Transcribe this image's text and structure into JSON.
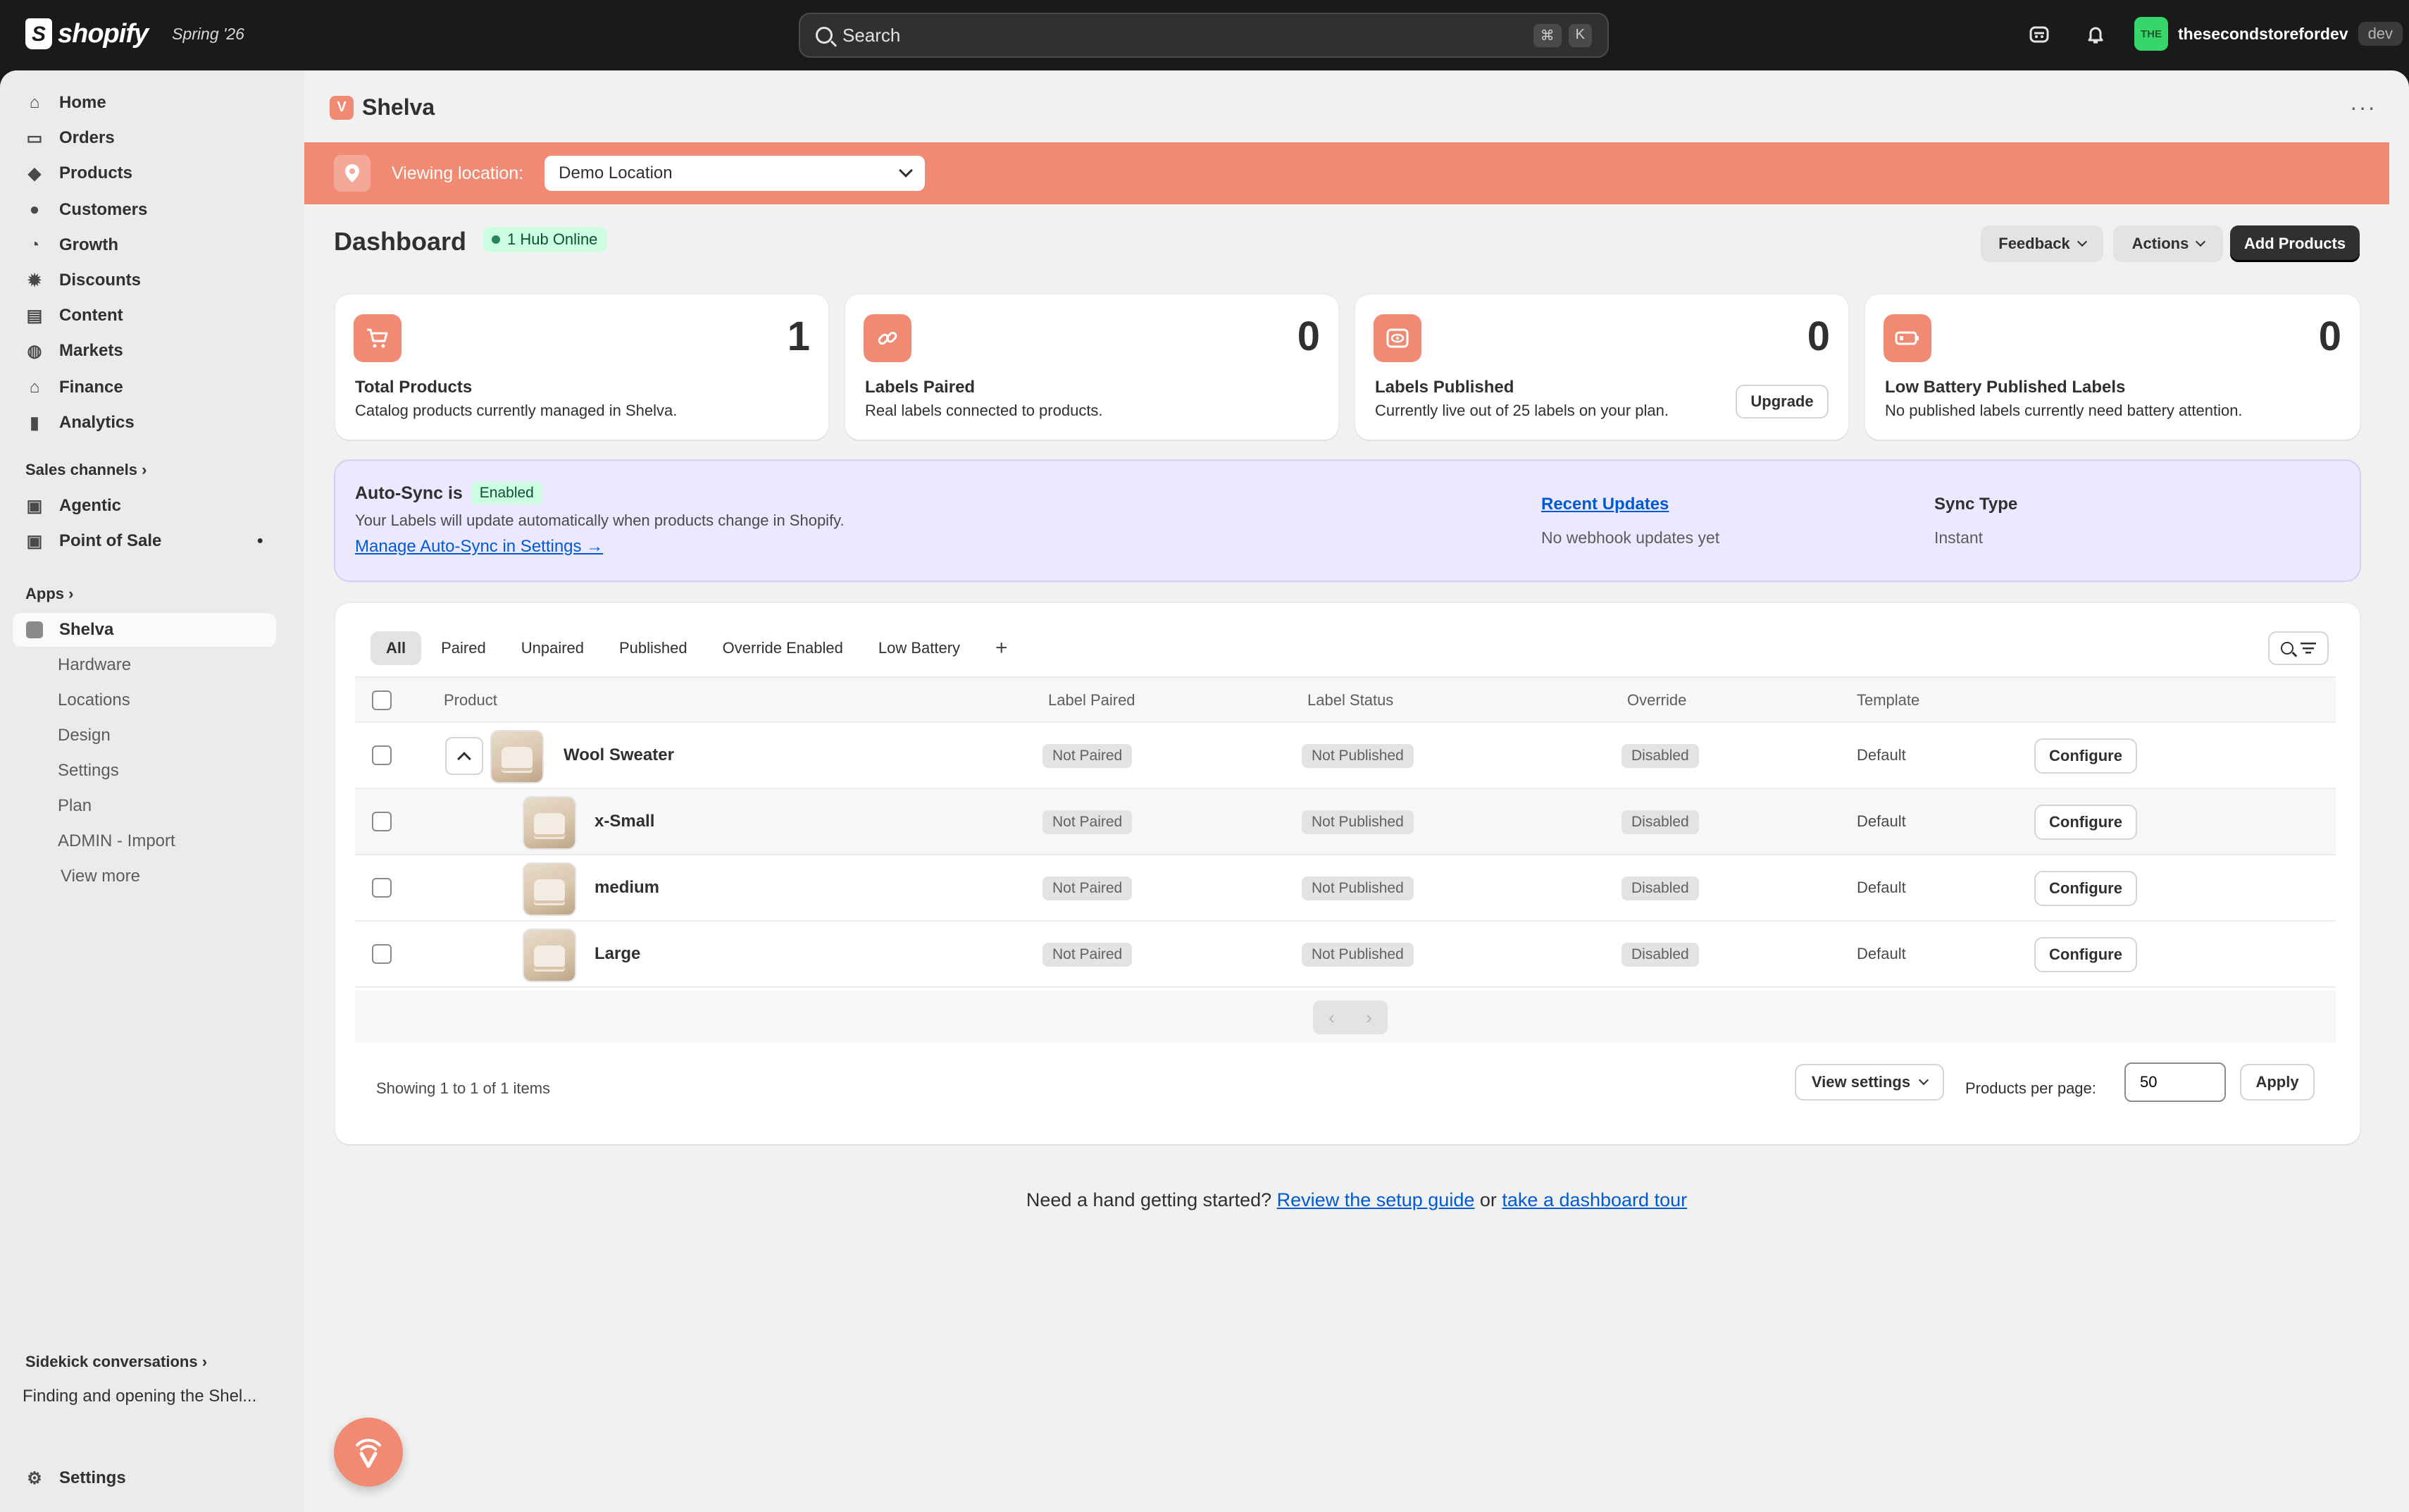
{
  "topbar": {
    "brand": "shopify",
    "season": "Spring '26",
    "search_placeholder": "Search",
    "shortcut_keys": [
      "⌘",
      "K"
    ],
    "store_avatar": "THE",
    "store_name": "thesecondstorefordev",
    "store_tag": "dev"
  },
  "sidebar": {
    "items": [
      {
        "label": "Home",
        "icon": "home-icon"
      },
      {
        "label": "Orders",
        "icon": "inbox-icon"
      },
      {
        "label": "Products",
        "icon": "tag-icon"
      },
      {
        "label": "Customers",
        "icon": "person-icon"
      },
      {
        "label": "Growth",
        "icon": "gauge-icon"
      },
      {
        "label": "Discounts",
        "icon": "discount-icon"
      },
      {
        "label": "Content",
        "icon": "content-icon"
      },
      {
        "label": "Markets",
        "icon": "globe-icon"
      },
      {
        "label": "Finance",
        "icon": "bank-icon"
      },
      {
        "label": "Analytics",
        "icon": "bar-chart-icon"
      }
    ],
    "sales_channels_label": "Sales channels",
    "channels": [
      {
        "label": "Agentic"
      },
      {
        "label": "Point of Sale"
      }
    ],
    "apps_label": "Apps",
    "app_active": "Shelva",
    "app_sub_items": [
      "Hardware",
      "Locations",
      "Design",
      "Settings",
      "Plan",
      "ADMIN - Import",
      "View more"
    ],
    "sidekick_label": "Sidekick conversations",
    "sidekick_recent": "Finding and opening the Shel...",
    "settings_label": "Settings"
  },
  "app": {
    "title": "Shelva",
    "logo_letter": "V",
    "location_label": "Viewing location:",
    "location_value": "Demo Location",
    "dashboard_title": "Dashboard",
    "hub_status": "1 Hub Online",
    "buttons": {
      "feedback": "Feedback",
      "actions": "Actions",
      "add_products": "Add Products"
    }
  },
  "stats": [
    {
      "value": "1",
      "label": "Total Products",
      "desc": "Catalog products currently managed in Shelva.",
      "icon": "cart-icon"
    },
    {
      "value": "0",
      "label": "Labels Paired",
      "desc": "Real labels connected to products.",
      "icon": "link-icon"
    },
    {
      "value": "0",
      "label": "Labels Published",
      "desc": "Currently live out of 25 labels on your plan.",
      "icon": "label-eye-icon",
      "action": "Upgrade"
    },
    {
      "value": "0",
      "label": "Low Battery Published Labels",
      "desc": "No published labels currently need battery attention.",
      "icon": "battery-icon"
    }
  ],
  "autosync": {
    "title": "Auto-Sync is",
    "status": "Enabled",
    "desc": "Your Labels will update automatically when products change in Shopify.",
    "link": "Manage Auto-Sync in Settings →",
    "recent_title": "Recent Updates",
    "recent_value": "No webhook updates yet",
    "sync_type_title": "Sync Type",
    "sync_type_value": "Instant"
  },
  "table": {
    "tabs": [
      "All",
      "Paired",
      "Unpaired",
      "Published",
      "Override Enabled",
      "Low Battery"
    ],
    "tab_add": "+",
    "columns": [
      "Product",
      "Label Paired",
      "Label Status",
      "Override",
      "Template"
    ],
    "rows": [
      {
        "name": "Wool Sweater",
        "paired": "Not Paired",
        "status": "Not Published",
        "override": "Disabled",
        "template": "Default",
        "action": "Configure"
      },
      {
        "name": "x-Small",
        "paired": "Not Paired",
        "status": "Not Published",
        "override": "Disabled",
        "template": "Default",
        "action": "Configure"
      },
      {
        "name": "medium",
        "paired": "Not Paired",
        "status": "Not Published",
        "override": "Disabled",
        "template": "Default",
        "action": "Configure"
      },
      {
        "name": "Large",
        "paired": "Not Paired",
        "status": "Not Published",
        "override": "Disabled",
        "template": "Default",
        "action": "Configure"
      }
    ],
    "pager_prev": "‹",
    "pager_next": "›",
    "showing": "Showing 1 to 1 of 1 items",
    "view_settings": "View settings",
    "per_page_label": "Products per page:",
    "per_page_value": "50",
    "apply": "Apply"
  },
  "help": {
    "prefix": "Need a hand getting started?",
    "link1": "Review the setup guide",
    "middle": "or",
    "link2": "take a dashboard tour"
  },
  "colors": {
    "accent": "#f08a72",
    "topbar": "#1a1a1a",
    "link": "#005bd3",
    "sync_bg": "#ebe8ff"
  }
}
